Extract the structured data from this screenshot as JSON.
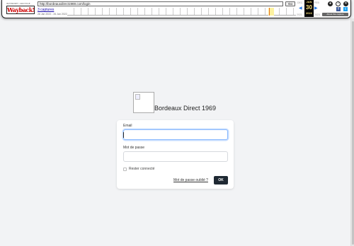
{
  "wayback": {
    "logo_top": "INTERNET ARCHIVE",
    "logo_main": "WaybackMachine",
    "url": "http://bordeauxdirect1969.com/login",
    "go_label": "Go",
    "captures_label": "3 captures",
    "date_range": "26 Jan 2022 - 26 Jan 2022",
    "prev_year": "2021",
    "next_year": "2023",
    "prev_month": "DEC",
    "next_month": "FEB",
    "calendar": {
      "month": "JAN",
      "day": "30",
      "year": "2022"
    },
    "about_label": "About this capture"
  },
  "page": {
    "brand_name": "Bordeaux Direct 1969",
    "login": {
      "email_label": "Email",
      "email_value": "",
      "password_label": "Mot de passe",
      "password_value": "",
      "remember_label": "Rester connecté",
      "remember_checked": false,
      "forgot_label": "Mot de passe oublié ?",
      "submit_label": "OK"
    }
  },
  "colors": {
    "page_background": "#f2f3f5",
    "submit_button": "#1f2933",
    "focus_ring": "#86b7fe"
  }
}
